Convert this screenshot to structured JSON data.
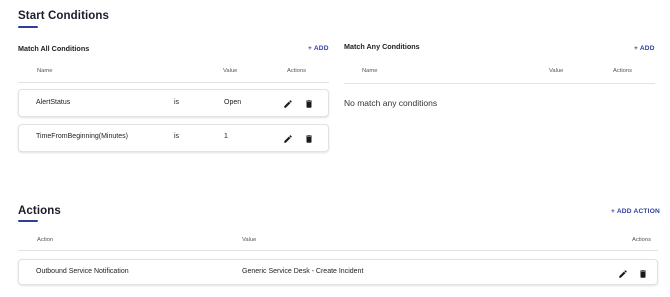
{
  "start_conditions": {
    "title": "Start Conditions",
    "match_all": {
      "title": "Match All Conditions",
      "add_label": "+ ADD",
      "columns": {
        "name": "Name",
        "value": "Value",
        "actions": "Actions"
      },
      "rows": [
        {
          "name": "AlertStatus",
          "operator": "is",
          "value": "Open"
        },
        {
          "name": "TimeFromBeginning(Minutes)",
          "operator": "is",
          "value": "1"
        }
      ]
    },
    "match_any": {
      "title": "Match Any Conditions",
      "add_label": "+ ADD",
      "columns": {
        "name": "Name",
        "value": "Value",
        "actions": "Actions"
      },
      "empty_message": "No match any conditions"
    }
  },
  "actions": {
    "title": "Actions",
    "add_label": "+ ADD ACTION",
    "columns": {
      "action": "Action",
      "value": "Value",
      "actions": "Actions"
    },
    "rows": [
      {
        "action": "Outbound Service Notification",
        "value": "Generic Service Desk - Create Incident"
      }
    ]
  },
  "icons": {
    "edit": "pencil-icon",
    "delete": "trash-icon"
  },
  "colors": {
    "accent": "#2f3e9e",
    "text": "#222222",
    "icon": "#1a1a1a"
  }
}
